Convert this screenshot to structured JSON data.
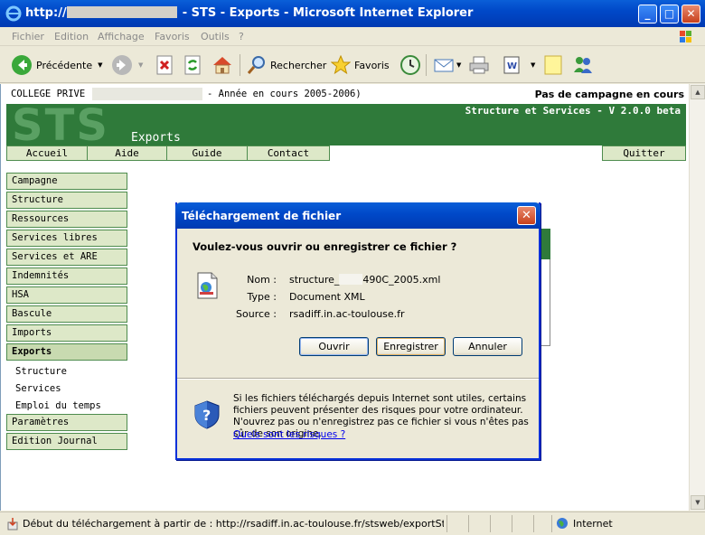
{
  "window": {
    "title_prefix": "http://",
    "title_suffix": "- STS - Exports - Microsoft Internet Explorer",
    "min_label": "_",
    "max_label": "□",
    "close_label": "✕"
  },
  "menu": [
    "Fichier",
    "Edition",
    "Affichage",
    "Favoris",
    "Outils",
    "?"
  ],
  "toolbar": {
    "back_label": "Précédente",
    "search_label": "Rechercher",
    "favorites_label": "Favoris"
  },
  "page": {
    "school_prefix": "COLLEGE PRIVE",
    "year": "- Année en cours 2005-2006)",
    "campaign": "Pas de campagne en cours",
    "logo": "STS",
    "section": "Exports",
    "version": "Structure et Services - V 2.0.0 beta",
    "nav": [
      "Accueil",
      "Aide",
      "Guide",
      "Contact"
    ],
    "quit": "Quitter",
    "sidebar": [
      "Campagne",
      "Structure",
      "Ressources",
      "Services libres",
      "Services et ARE",
      "Indemnités",
      "HSA",
      "Bascule",
      "Imports",
      "Exports"
    ],
    "sub": [
      "Structure",
      "Services",
      "Emploi du temps"
    ],
    "sidebar_after": [
      "Paramètres",
      "Edition Journal"
    ]
  },
  "dialog": {
    "title": "Téléchargement de fichier",
    "close_label": "✕",
    "question": "Voulez-vous ouvrir ou enregistrer ce fichier ?",
    "name_label": "Nom :",
    "name_prefix": "structure_",
    "name_suffix": "490C_2005.xml",
    "type_label": "Type :",
    "type_value": "Document XML",
    "source_label": "Source :",
    "source_value": "rsadiff.in.ac-toulouse.fr",
    "open_button": "Ouvrir",
    "save_button": "Enregistrer",
    "cancel_button": "Annuler",
    "warning": "Si les fichiers téléchargés depuis Internet sont utiles, certains fichiers peuvent présenter des risques pour votre ordinateur. N'ouvrez pas ou n'enregistrez pas ce fichier si vous n'êtes pas sûr de son origine.",
    "risk_link": "Quels sont les risques ?"
  },
  "status": {
    "text": "Début du téléchargement à partir de : http://rsadiff.in.ac-toulouse.fr/stsweb/exportStructure.st",
    "zone": "Internet"
  },
  "scroll": {
    "up_label": "▲",
    "down_label": "▼"
  }
}
